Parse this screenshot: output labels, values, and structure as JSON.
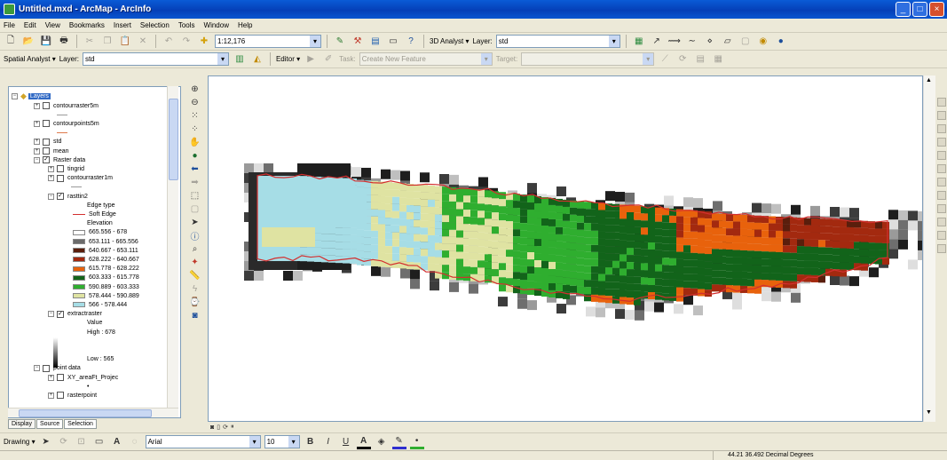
{
  "window": {
    "title": "Untitled.mxd - ArcMap - ArcInfo",
    "buttons": {
      "minimize": "_",
      "maximize": "□",
      "close": "×"
    }
  },
  "menu": [
    "File",
    "Edit",
    "View",
    "Bookmarks",
    "Insert",
    "Selection",
    "Tools",
    "Window",
    "Help"
  ],
  "standard_toolbar": {
    "scale": "1:12,176",
    "analyst_label": "3D Analyst ▾",
    "layer_label": "Layer:",
    "layer_value": "std"
  },
  "spatial_toolbar": {
    "spatial_label": "Spatial Analyst ▾",
    "layer_label": "Layer:",
    "layer_value": "std",
    "editor_label": "Editor ▾",
    "task_label": "Task:",
    "task_value": "Create New Feature",
    "target_label": "Target:",
    "target_value": ""
  },
  "toc": {
    "root": "Layers",
    "items": [
      {
        "type": "layer",
        "label": "contourraster5m",
        "checked": false,
        "expand": "+"
      },
      {
        "type": "line",
        "color": "#9a9a9a"
      },
      {
        "type": "layer",
        "label": "contourpoints5m",
        "checked": false,
        "expand": "+"
      },
      {
        "type": "line",
        "color": "#e07a4c"
      },
      {
        "type": "layer",
        "label": "std",
        "checked": false,
        "expand": "+"
      },
      {
        "type": "layer",
        "label": "mean",
        "checked": false,
        "expand": "+"
      },
      {
        "type": "layer",
        "label": "Raster data",
        "checked": true,
        "expand": "−"
      },
      {
        "type": "layer",
        "label": "tingrid",
        "checked": false,
        "expand": "+",
        "indent": 1
      },
      {
        "type": "layer",
        "label": "contourraster1m",
        "checked": false,
        "expand": "+",
        "indent": 1
      },
      {
        "type": "line",
        "color": "#9a9a9a",
        "indent": 1
      },
      {
        "type": "layer",
        "label": "rasttin2",
        "checked": true,
        "expand": "−",
        "indent": 1
      },
      {
        "type": "text",
        "label": "Edge type",
        "indent": 3
      },
      {
        "type": "legend",
        "label": "Soft Edge",
        "color": "#d32f2f",
        "thin": true
      },
      {
        "type": "text",
        "label": "Elevation",
        "indent": 3
      },
      {
        "type": "legend",
        "label": "665.556 - 678",
        "color": "#ffffff"
      },
      {
        "type": "legend",
        "label": "653.111 - 665.556",
        "color": "#6b6b6b"
      },
      {
        "type": "legend",
        "label": "640.667 - 653.111",
        "color": "#5a1e0c"
      },
      {
        "type": "legend",
        "label": "628.222 - 640.667",
        "color": "#a3290f"
      },
      {
        "type": "legend",
        "label": "615.778 - 628.222",
        "color": "#e8620c"
      },
      {
        "type": "legend",
        "label": "603.333 - 615.778",
        "color": "#12641a"
      },
      {
        "type": "legend",
        "label": "590.889 - 603.333",
        "color": "#2fae2f"
      },
      {
        "type": "legend",
        "label": "578.444 - 590.889",
        "color": "#dfe3a2"
      },
      {
        "type": "legend",
        "label": "566 - 578.444",
        "color": "#a6dde6"
      },
      {
        "type": "layer",
        "label": "extractraster",
        "checked": true,
        "expand": "−",
        "indent": 1
      },
      {
        "type": "text",
        "label": "Value",
        "indent": 3
      },
      {
        "type": "text",
        "label": "High : 678",
        "indent": 3
      },
      {
        "type": "gap"
      },
      {
        "type": "gap"
      },
      {
        "type": "text",
        "label": "Low : 565",
        "indent": 3
      },
      {
        "type": "layer",
        "label": "point data",
        "checked": false,
        "expand": "−"
      },
      {
        "type": "layer",
        "label": "XY_areaFt_Projec",
        "checked": false,
        "expand": "+",
        "indent": 1
      },
      {
        "type": "text",
        "label": "•",
        "indent": 3
      },
      {
        "type": "layer",
        "label": "rasterpoint",
        "checked": false,
        "expand": "+",
        "indent": 1
      }
    ],
    "tabs": [
      "Display",
      "Source",
      "Selection"
    ]
  },
  "drawing_toolbar": {
    "drawing_label": "Drawing ▾",
    "font": "Arial",
    "size": "10",
    "bold": "B",
    "italic": "I",
    "underline": "U",
    "text_symbol": "A"
  },
  "status": {
    "coords": "44.21  36.492 Decimal Degrees"
  },
  "map": {
    "elevation_palette": [
      "#a6dde6",
      "#dfe3a2",
      "#2fae2f",
      "#12641a",
      "#e8620c",
      "#a3290f",
      "#5a1e0c",
      "#6b6b6b"
    ],
    "boundary_color": "#d32f2f",
    "std_shades": [
      "#1e1e1e",
      "#3c3c3c",
      "#6e6e6e",
      "#9a9a9a",
      "#bfbfbf",
      "#dedede"
    ]
  }
}
